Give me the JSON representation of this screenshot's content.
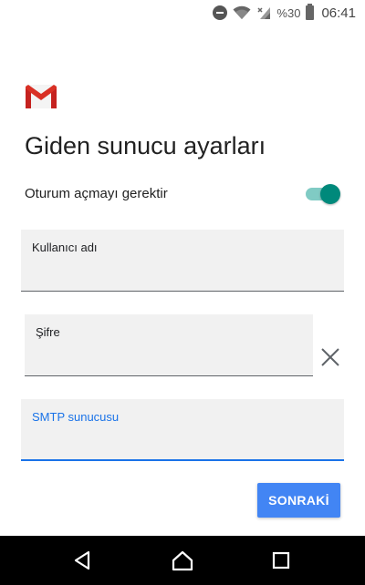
{
  "status_bar": {
    "battery_percent": "%30",
    "time": "06:41",
    "icons": [
      "do-not-disturb-icon",
      "wifi-icon",
      "signal-icon",
      "battery-icon"
    ]
  },
  "app": {
    "logo_icon": "gmail-logo",
    "title": "Giden sunucu ayarları"
  },
  "auth_toggle": {
    "label": "Oturum açmayı gerektir",
    "checked": true,
    "track_color": "#80cbc4",
    "thumb_color": "#00897b"
  },
  "fields": {
    "username": {
      "label": "Kullanıcı adı",
      "value": ""
    },
    "password": {
      "label": "Şifre",
      "value": ""
    },
    "smtp_server": {
      "label": "SMTP sunucusu",
      "value": "",
      "focused": true
    }
  },
  "clear_icon": "close-icon",
  "next_button": {
    "label": "SONRAKİ",
    "color": "#4285f4"
  },
  "nav_bar": {
    "icons": [
      "back-icon",
      "home-icon",
      "recents-icon"
    ]
  }
}
